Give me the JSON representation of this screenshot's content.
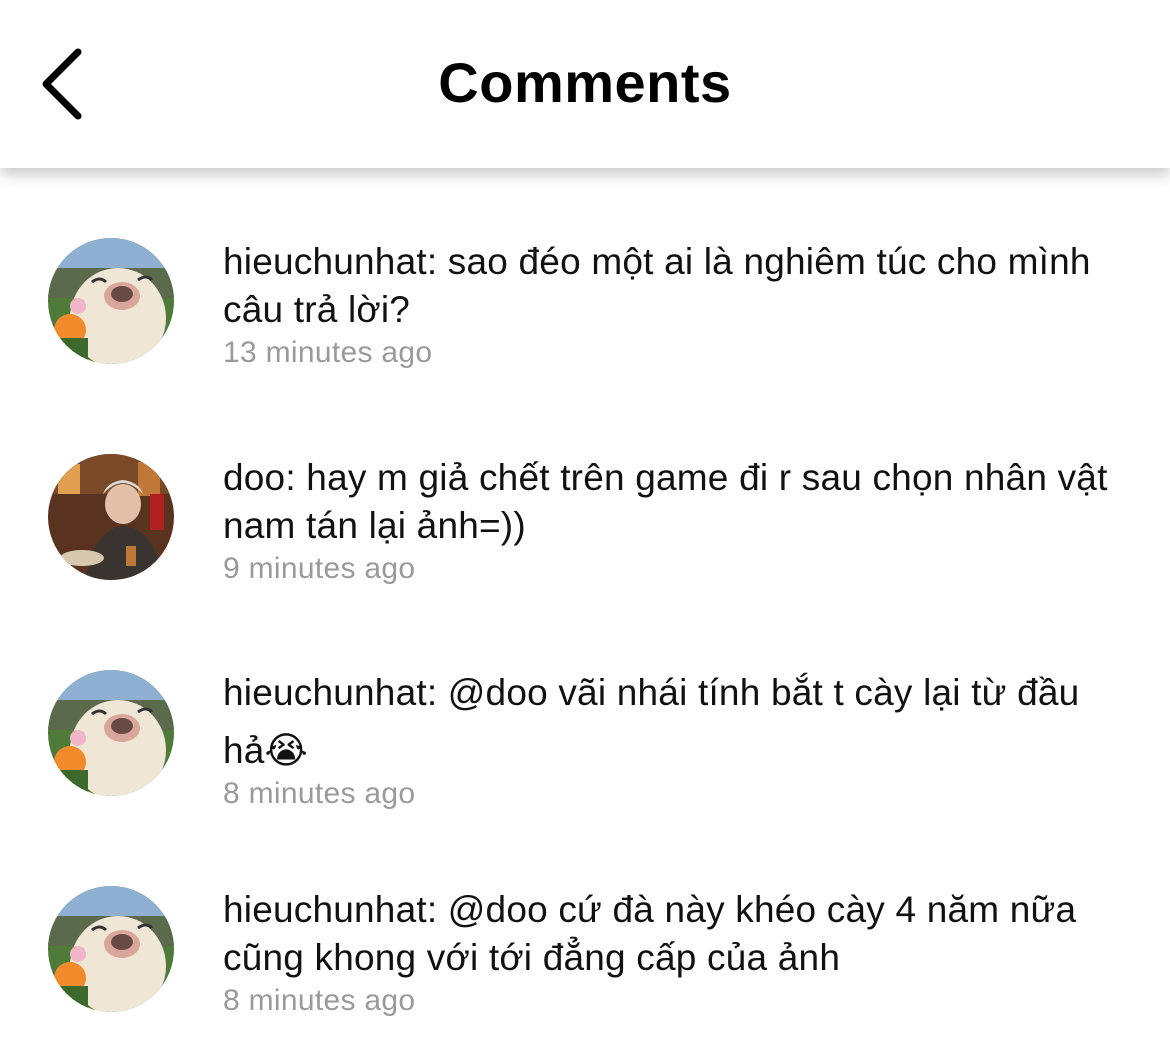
{
  "header": {
    "title": "Comments",
    "back_icon": "chevron-left-icon"
  },
  "comments": [
    {
      "username": "hieuchunhat",
      "text": "hieuchunhat: sao đéo một ai là nghiêm túc cho mình câu trả lời?",
      "time": "13 minutes ago",
      "avatar": "dog-avatar"
    },
    {
      "username": "doo",
      "text": "doo: hay m giả chết trên game đi r sau chọn nhân vật nam tán lại ảnh=))",
      "time": "9 minutes ago",
      "avatar": "person-avatar"
    },
    {
      "username": "hieuchunhat",
      "text": "hieuchunhat: @doo vãi nhái tính bắt t cày lại từ đầu hả😭",
      "time": "8 minutes ago",
      "avatar": "dog-avatar"
    },
    {
      "username": "hieuchunhat",
      "text": "hieuchunhat: @doo cứ đà này khéo cày 4 năm nữa cũng khong với tới đẳng cấp của ảnh",
      "time": "8 minutes ago",
      "avatar": "dog-avatar"
    }
  ]
}
